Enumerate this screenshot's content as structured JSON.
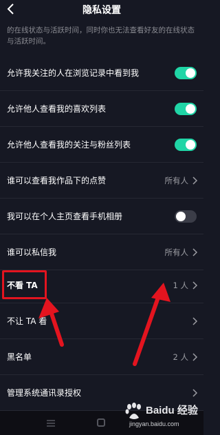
{
  "header": {
    "title": "隐私设置"
  },
  "description": "的在线状态与活跃时间，同时你也无法查看好友的在线状态与活跃时间。",
  "rows": [
    {
      "label": "允许我关注的人在浏览记录中看到我",
      "toggle": "on"
    },
    {
      "label": "允许他人查看我的喜欢列表",
      "toggle": "on"
    },
    {
      "label": "允许他人查看我的关注与粉丝列表",
      "toggle": "on"
    },
    {
      "label": "谁可以查看我作品下的点赞",
      "value": "所有人"
    },
    {
      "label": "我可以在个人主页查看手机相册",
      "toggle": "off"
    },
    {
      "label": "谁可以私信我",
      "value": "所有人"
    },
    {
      "label": "不看 TA",
      "value": "1 人"
    },
    {
      "label": "不让 TA 看",
      "value": ""
    },
    {
      "label": "黑名单",
      "value": "2 人"
    },
    {
      "label": "管理系统通讯录授权",
      "value": ""
    }
  ],
  "watermark": {
    "brand": "Baidu 经验",
    "url": "jingyan.baidu.com"
  },
  "colors": {
    "background": "#161823",
    "toggle_on": "#20d5a6",
    "annotation": "#e3141f"
  }
}
